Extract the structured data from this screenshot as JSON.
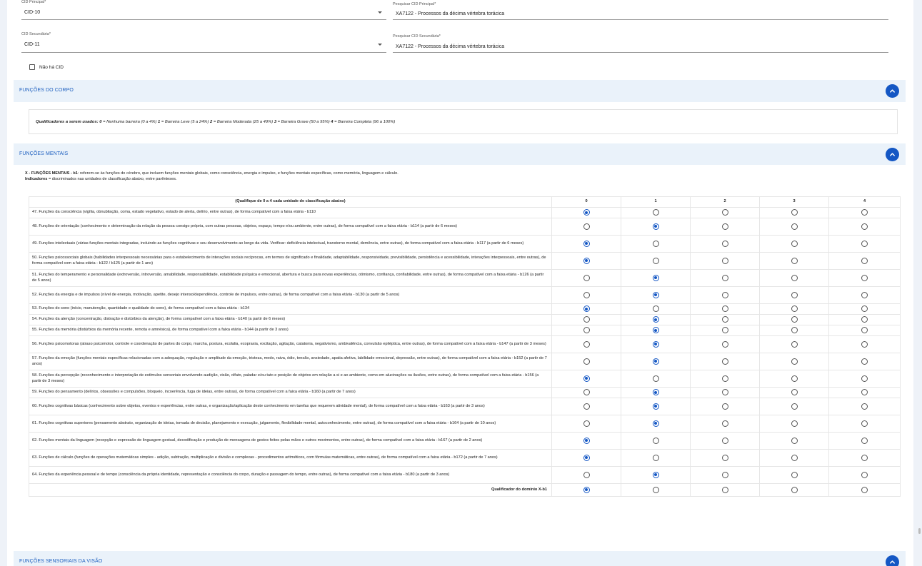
{
  "cid": {
    "principal_label": "CID Principal*",
    "principal_value": "CID-10",
    "search_principal_label": "Pesquisar CID Principal*",
    "search_principal_value": "XA7122 - Processos da décima vértebra torácica",
    "secundaria_label": "CID Secundária*",
    "secundaria_value": "CID-11",
    "search_secundaria_label": "Pesquisar CID Secundária*",
    "search_secundaria_value": "XA7122 - Processos da décima vértebra torácica",
    "no_cid_label": "Não há CID"
  },
  "sections": {
    "corpo": "FUNÇÕES DO CORPO",
    "mentais": "FUNÇÕES MENTAIS",
    "visao": "FUNÇÕES SENSORIAIS DA VISÃO"
  },
  "qualifiers": {
    "lead": "Qualificadores a serem usados:",
    "items": [
      {
        "num": "0",
        "text": "= Nenhuma barreira (0 a 4%)"
      },
      {
        "num": "1",
        "text": "= Barreira Leve (5 a 24%)"
      },
      {
        "num": "2",
        "text": "= Barreira Moderada (25 a 49%)"
      },
      {
        "num": "3",
        "text": "= Barreira Grave (50 a 95%)"
      },
      {
        "num": "4",
        "text": "= Barreira Completa (96 a 100%)"
      }
    ]
  },
  "intro": {
    "title": "X - FUNÇÕES MENTAIS - b1",
    "text": ": referem-se às funções do cérebro, que incluem funções mentais globais, como consciência, energia e impulso, e funções mentais específicas, como memória, linguagem e cálculo.",
    "indicators_label": "Indicadores",
    "indicators_text": " = discriminados nas unidades de classificação abaixo, entre parênteses."
  },
  "table": {
    "header": "(Qualifique de 0 a 4 cada unidade de classificação abaixo)",
    "columns": [
      "0",
      "1",
      "2",
      "3",
      "4"
    ],
    "footer_label": "Qualificador do domínio X-b1",
    "footer_selected": 0,
    "rows": [
      {
        "text": "47. Funções da consciência (vigília, obnubilação, coma, estado vegetativo, estado de alerta, delírio, entre outras), de forma compatível com a faixa etária - b110",
        "selected": 0
      },
      {
        "text": "48. Funções de orientação (conhecimento e determinação da relação da pessoa consigo própria, com outras pessoas, objetos, espaço, tempo e/ou ambiente, entre outras), de forma compatível com a faixa etária - b114 (a partir de 6 meses)",
        "selected": 1
      },
      {
        "text": "49. Funções intelectuais (várias funções mentais integradas, incluindo as funções cognitivas e seu desenvolvimento ao longo da vida. Verificar: deficiência intelectual, transtorno mental, demência, entre outras), de forma compatível com a faixa etária - b117 (a partir de 6 meses)",
        "selected": 0
      },
      {
        "text": "50. Funções psicossociais globais (habilidades interpessoais necessárias para o estabelecimento de interações sociais recíprocas, em termos de significado e finalidade, adaptabilidade, responsividade, previsibilidade, persistência e acessibilidade, interações interpessoais, entre outras), de forma compatível com a faixa etária - b122 / b125 (a partir de 1 ano)",
        "selected": 0
      },
      {
        "text": "51. Funções do temperamento e personalidade (extroversão, introversão, amabilidade, responsabilidade, estabilidade psíquica e emocional, abertura e busca para novas experiências, otimismo, confiança, confiabilidade, entre outras), de forma compatível com a faixa etária - b126 (a partir de 5 anos)",
        "selected": 1
      },
      {
        "text": "52. Funções da energia e de impulsos (nível de energia, motivação, apetite, desejo intenso/dependência, controle de impulsos, entre outras), de forma compatível com a faixa etária - b130 (a partir de 5 anos)",
        "selected": 1
      },
      {
        "text": "53. Funções do sono (início, manutenção, quantidade e qualidade do sono), de forma compatível com a faixa etária - b134",
        "selected": 0
      },
      {
        "text": "54. Funções da atenção (concentração, distração e distúrbios da atenção), de forma compatível com a faixa etária - b140 (a partir de 6 meses)",
        "selected": 1
      },
      {
        "text": "55. Funções da memória (distúrbios da memória recente, remota e amnésica), de forma compatível com a faixa etária - b144 (a partir de 3 anos)",
        "selected": 1
      },
      {
        "text": "56. Funções psicomotoras (atraso psicomotor, controle e coordenação de partes do corpo, marcha, postura, ecolalia, ecopraxia, excitação, agitação, catatonia, negativismo, ambivalência, convulsão epiléptica, entre outras), de forma compatível com a faixa etária - b147 (a partir de 3 meses)",
        "selected": 1
      },
      {
        "text": "57. Funções da emoção (funções mentais específicas relacionadas com a adequação, regulação e amplitude da emoção, tristeza, medo, raiva, ódio, tensão, ansiedade, apatia afetiva, labilidade emocional, depressão, entre outras), de forma compatível com a faixa etária - b152 (a partir de 7 anos)",
        "selected": 1
      },
      {
        "text": "58. Funções da percepção (reconhecimento e interpretação de estímulos sensoriais envolvendo audição, visão, olfato, paladar e/ou tato e posição de objetos em relação a si e ao ambiente, como em alucinações ou ilusões, entre outras), de forma compatível com a faixa etária - b156 (a partir de 3 meses)",
        "selected": 0
      },
      {
        "text": "59. Funções do pensamento (delírios, obsessões e compulsões, bloqueio, incoerência, fuga de ideias, entre outras), de forma compatível com a faixa etária - b160 (a partir de 7 anos)",
        "selected": 1
      },
      {
        "text": "60. Funções cognitivas básicas (conhecimento sobre objetos, eventos e experiências, entre outras, e organização/aplicação deste conhecimento em tarefas que requerem atividade mental), de forma compatível com a faixa etária - b163 (a partir de 3 anos)",
        "selected": 1
      },
      {
        "text": "61. Funções cognitivas superiores (pensamento abstrato, organização de ideias, tomada de decisão, planejamento e execução, julgamento, flexibilidade mental, autoconhecimento, entre outras), de forma compatível com a faixa etária - b164 (a partir de 10 anos)",
        "selected": 1
      },
      {
        "text": "62. Funções mentais da linguagem (recepção e expressão de linguagem gestual, decodificação e produção de mensagens de gestos feitos pelas mãos e outros movimentos, entre outras), de forma compatível com a faixa etária - b167 (a partir de 2 anos)",
        "selected": 0
      },
      {
        "text": "63. Funções de cálculo (funções de operações matemáticas simples - adição, subtração, multiplicação e divisão e complexas - procedimentos aritméticos, com fórmulas matemáticas, entre outras), de forma compatível com a faixa etária - b172 (a partir de 7 anos)",
        "selected": 0
      },
      {
        "text": "64. Funções da experiência pessoal e de tempo (consciência da própria identidade, representação e consciência do corpo, duração e passagem do tempo, entre outras), de forma compatível com a faixa etária - b180 (a partir de 3 anos)",
        "selected": 1
      }
    ]
  }
}
